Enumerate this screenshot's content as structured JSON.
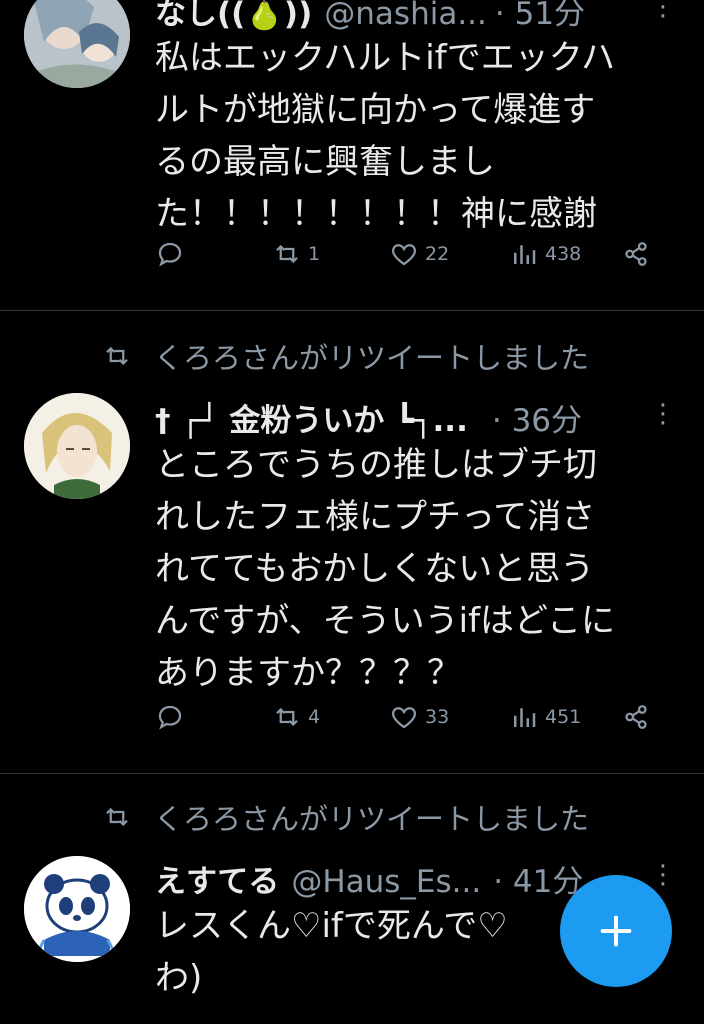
{
  "tweets": [
    {
      "retweeted_by": "",
      "name": "なし((🍐))",
      "handle": "@nashia...",
      "time": "· 51分",
      "text": "私はエックハルトifでエックハ\nルトが地獄に向かって爆進す\nるの最高に興奮しまし\nた！！！！！！！！神に感謝",
      "replies": "",
      "retweets": "1",
      "likes": "22",
      "views": "438"
    },
    {
      "retweeted_by": "くろろさんがリツイートしました",
      "name": "† ┌┘ 金粉ういか ┗┐...",
      "handle": "",
      "time": "· 36分",
      "text": "ところでうちの推しはブチ切\nれしたフェ様にプチって消さ\nれててもおかしくないと思う\nんですが、そういうifはどこに\nありますか？？？？",
      "replies": "",
      "retweets": "4",
      "likes": "33",
      "views": "451"
    },
    {
      "retweeted_by": "くろろさんがリツイートしました",
      "name": "えすてる",
      "handle": "@Haus_Es...",
      "time": "· 41分",
      "text": "レスくん♡ifで死んで♡\nわ)",
      "replies": "",
      "retweets": "",
      "likes": "",
      "views": ""
    }
  ],
  "fab": {
    "icon": "plus-icon",
    "color": "#1d9bf0"
  },
  "icons": {
    "reply": "reply-icon",
    "retweet": "retweet-icon",
    "like": "heart-icon",
    "views": "views-icon",
    "share": "share-icon",
    "more": "more-icon"
  }
}
